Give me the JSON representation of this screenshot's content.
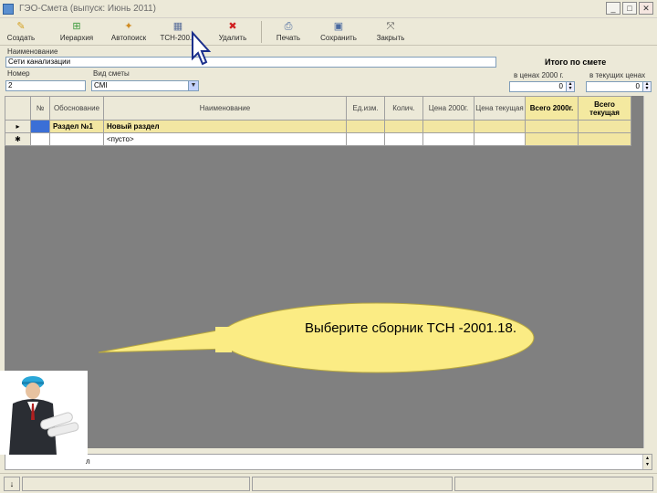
{
  "window": {
    "title": "ГЭО-Смета  (выпуск: Июнь 2011)",
    "buttons": [
      "_",
      "□",
      "✕"
    ]
  },
  "toolbar": {
    "items": [
      {
        "label": "Создать",
        "icon": "new-doc-icon",
        "glyph": "✎",
        "color": "#d4a020"
      },
      {
        "label": "Иерархия",
        "icon": "hierarchy-icon",
        "glyph": "⊞",
        "color": "#3a9a3a"
      },
      {
        "label": "Автопоиск",
        "icon": "autosearch-icon",
        "glyph": "✦",
        "color": "#d08a20"
      },
      {
        "label": "ТСН-200...",
        "icon": "tsn-collection-icon",
        "glyph": "▦",
        "color": "#5a6f9a"
      },
      {
        "label": "Удалить",
        "icon": "delete-icon",
        "glyph": "✖",
        "color": "#d02020"
      },
      {
        "label": "Печать",
        "icon": "print-icon",
        "glyph": "⎙",
        "color": "#4a6aa0"
      },
      {
        "label": "Сохранить",
        "icon": "save-icon",
        "glyph": "▣",
        "color": "#4a6aa0"
      },
      {
        "label": "Закрыть",
        "icon": "close-window-icon",
        "glyph": "⤧",
        "color": "#555555"
      }
    ]
  },
  "form": {
    "name_label": "Наименование",
    "name_value": "Сети канализации",
    "number_label": "Номер",
    "number_value": "2",
    "type_label": "Вид сметы",
    "type_value": "СМI",
    "total_title": "Итого по смете",
    "price2000_label": "в ценах 2000 г.",
    "price2000_value": "0",
    "current_label": "в текущих ценах",
    "current_value": "0"
  },
  "grid": {
    "columns": [
      "",
      "№",
      "Обоснование",
      "Наименование",
      "Ед.изм.",
      "Колич.",
      "Цена 2000г.",
      "Цена текущая",
      "Всего 2000г.",
      "Всего текущая"
    ],
    "rows": [
      {
        "marker": "▸",
        "num": "",
        "basis": "Раздел №1",
        "name": "Новый раздел",
        "unit": "",
        "qty": "",
        "p2000": "",
        "pcur": "",
        "t2000": "",
        "tcur": ""
      },
      {
        "marker": "✱",
        "num": "",
        "basis": "",
        "name": "<пусто>",
        "unit": "",
        "qty": "",
        "p2000": "",
        "pcur": "",
        "t2000": "",
        "tcur": ""
      }
    ]
  },
  "bottom": {
    "hint_prefix": "л",
    "status_left": "",
    "status_icon": "↓"
  },
  "tutorial": {
    "bubble_text": "Выберите сборник ТСН -2001.18."
  },
  "colors": {
    "selection": "#3b6fd6",
    "gold": "#f2e6a2",
    "bubble": "#fbec84"
  }
}
